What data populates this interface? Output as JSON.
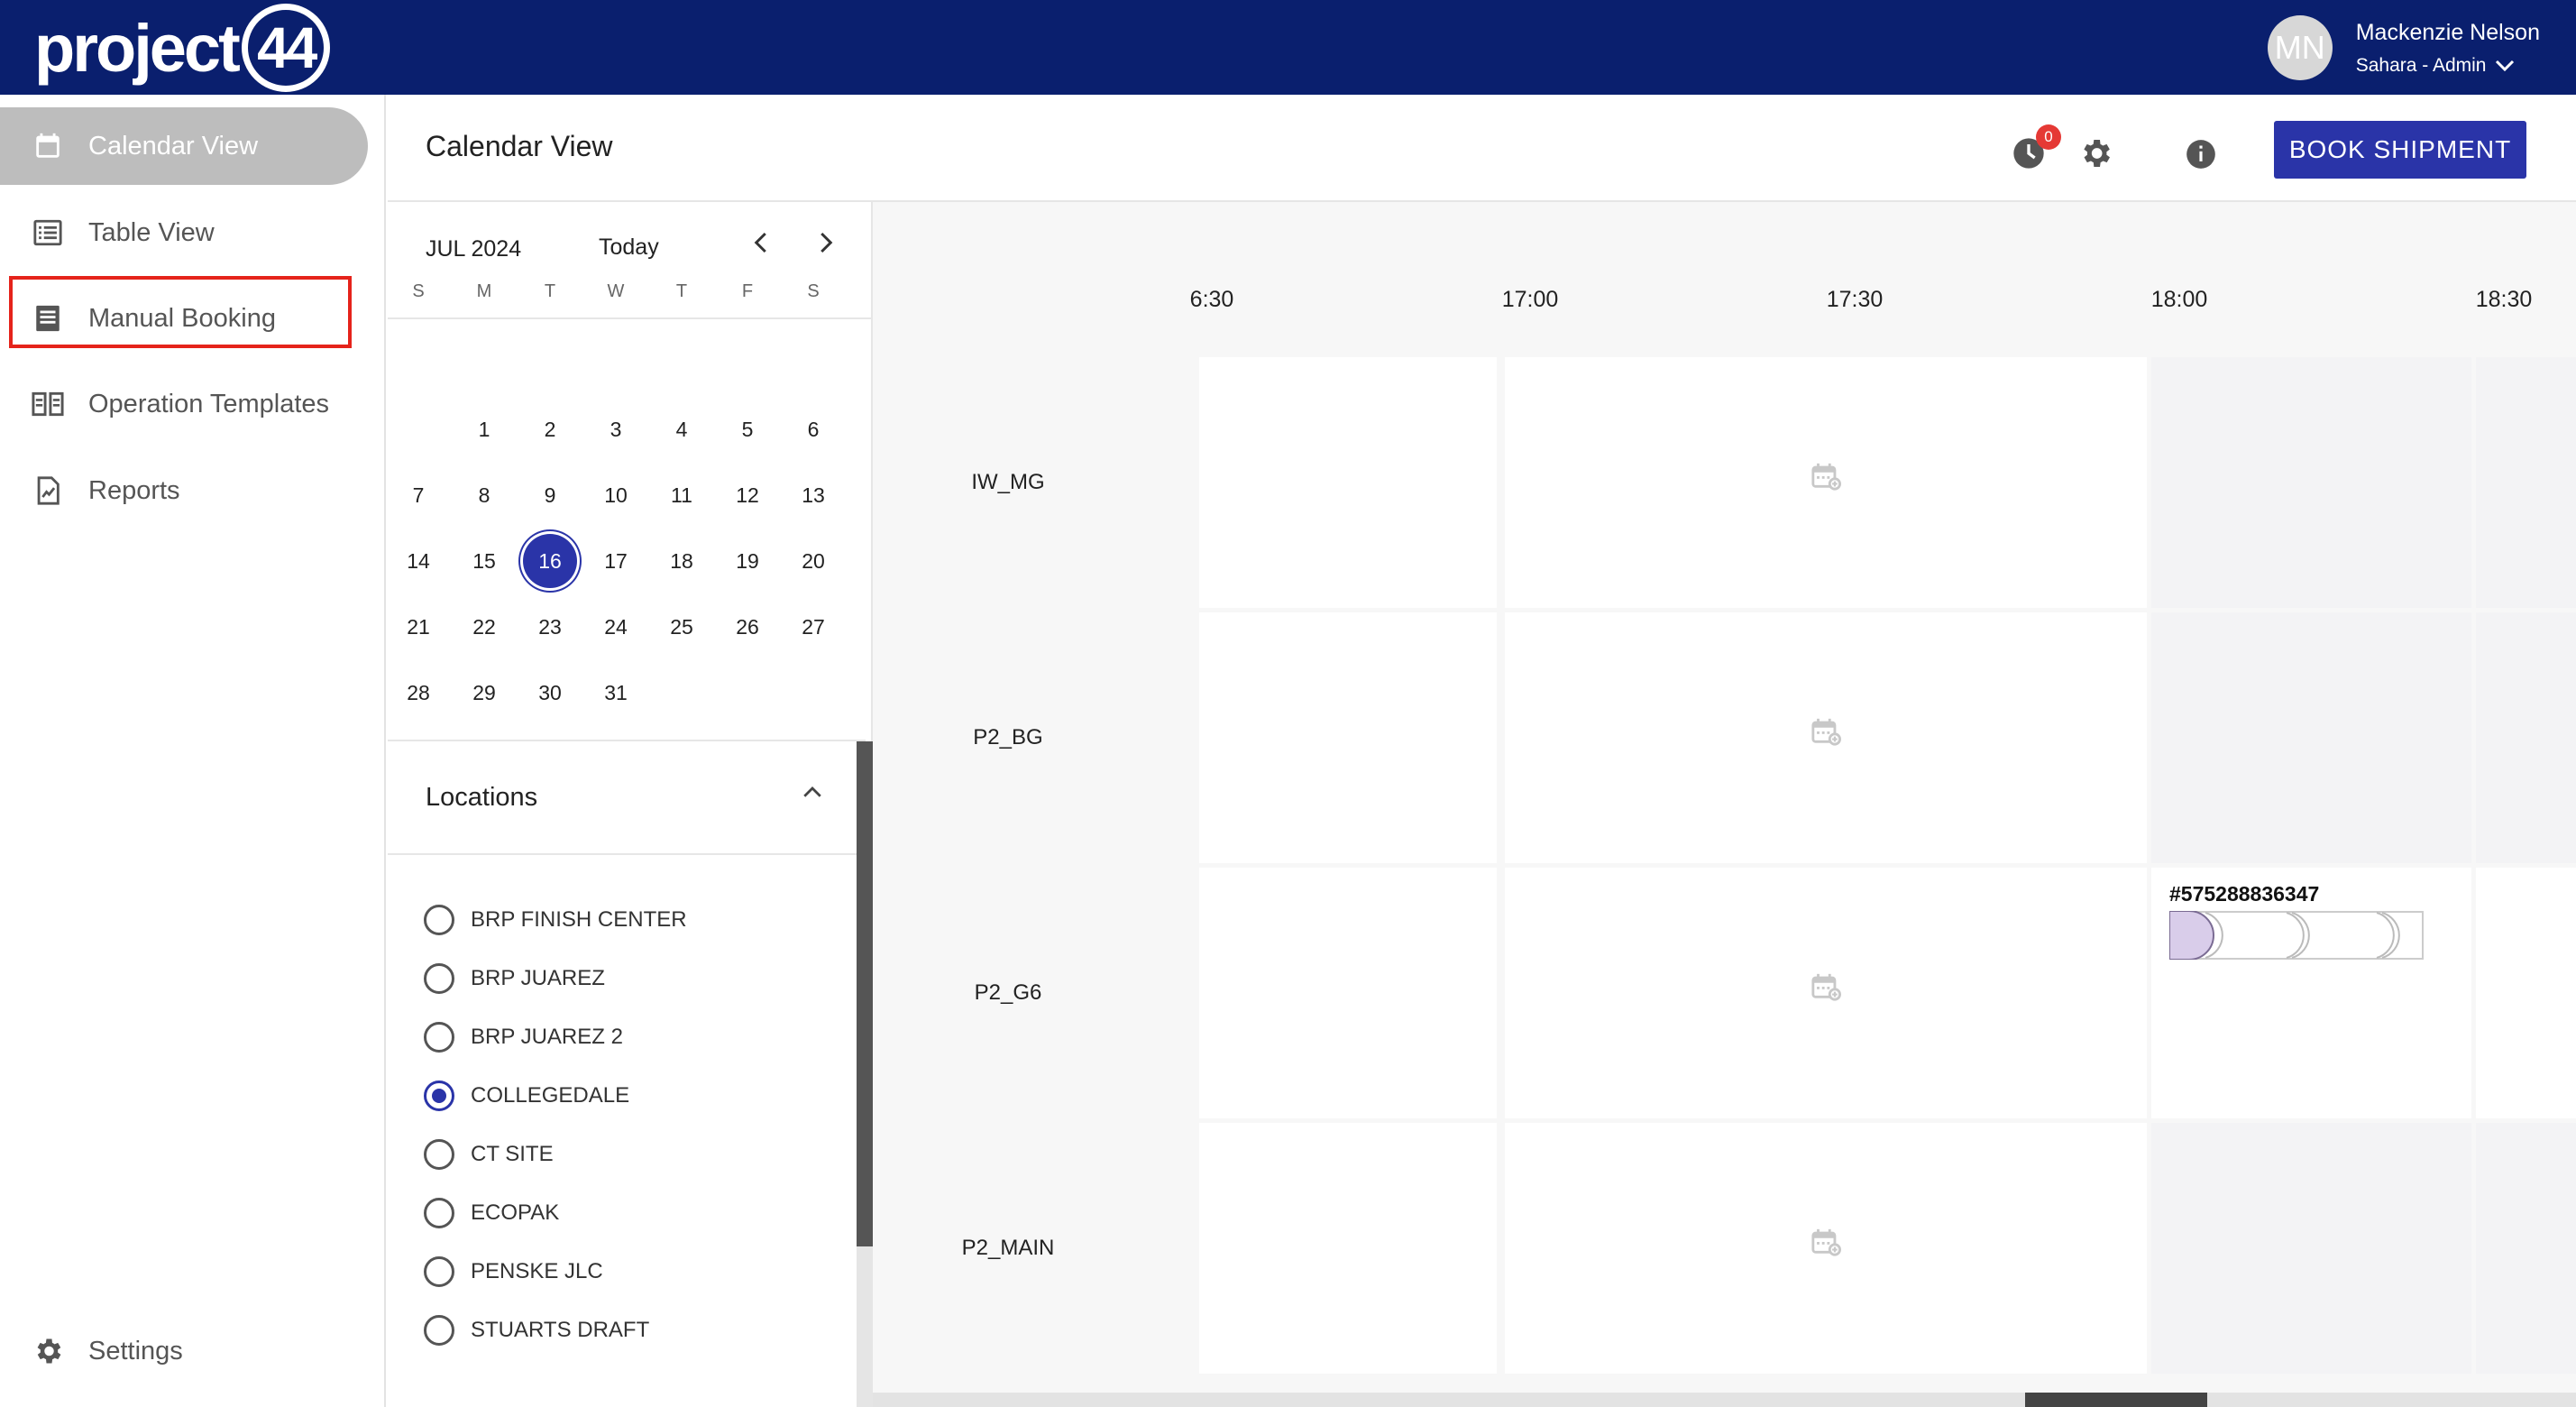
{
  "header": {
    "logo_text": "project",
    "logo_ring_text": "44",
    "user_initials": "MN",
    "user_name": "Mackenzie Nelson",
    "user_role": "Sahara - Admin"
  },
  "sidebar": {
    "items": [
      {
        "label": "Calendar View",
        "icon": "calendar-icon",
        "active": true
      },
      {
        "label": "Table View",
        "icon": "list-icon"
      },
      {
        "label": "Manual Booking",
        "icon": "form-icon"
      },
      {
        "label": "Operation Templates",
        "icon": "book-open-icon"
      },
      {
        "label": "Reports",
        "icon": "report-icon"
      }
    ],
    "settings_label": "Settings"
  },
  "main": {
    "title": "Calendar View",
    "notification_count": "0",
    "book_button": "BOOK SHIPMENT"
  },
  "mini_calendar": {
    "month_label": "JUL 2024",
    "today_label": "Today",
    "weekdays": [
      "S",
      "M",
      "T",
      "W",
      "T",
      "F",
      "S"
    ],
    "days": [
      "1",
      "2",
      "3",
      "4",
      "5",
      "6",
      "7",
      "8",
      "9",
      "10",
      "11",
      "12",
      "13",
      "14",
      "15",
      "16",
      "17",
      "18",
      "19",
      "20",
      "21",
      "22",
      "23",
      "24",
      "25",
      "26",
      "27",
      "28",
      "29",
      "30",
      "31"
    ],
    "selected_day": "16",
    "first_weekday_index": 1
  },
  "locations": {
    "title": "Locations",
    "items": [
      {
        "label": "BRP FINISH CENTER",
        "selected": false
      },
      {
        "label": "BRP JUAREZ",
        "selected": false
      },
      {
        "label": "BRP JUAREZ 2",
        "selected": false
      },
      {
        "label": "COLLEGEDALE",
        "selected": true
      },
      {
        "label": "CT SITE",
        "selected": false
      },
      {
        "label": "ECOPAK",
        "selected": false
      },
      {
        "label": "PENSKE JLC",
        "selected": false
      },
      {
        "label": "STUARTS DRAFT",
        "selected": false
      }
    ]
  },
  "timeline": {
    "times": [
      "6:30",
      "17:00",
      "17:30",
      "18:00",
      "18:30"
    ],
    "rows": [
      "IW_MG",
      "P2_BG",
      "P2_G6",
      "P2_MAIN"
    ],
    "shipment_id": "#575288836347",
    "accent_color": "#2a34a8",
    "header_color": "#0a1f6e"
  }
}
